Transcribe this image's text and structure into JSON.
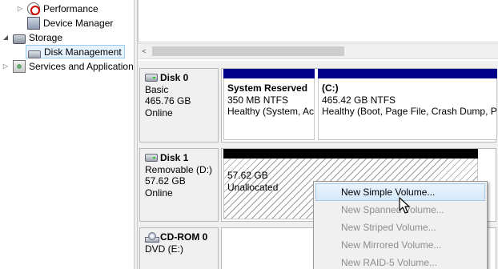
{
  "tree": {
    "items": [
      {
        "label": "Performance",
        "icon": "performance-icon",
        "expander": "▷"
      },
      {
        "label": "Device Manager",
        "icon": "device-manager-icon",
        "expander": ""
      },
      {
        "label": "Storage",
        "icon": "storage-icon",
        "expander": "◢"
      },
      {
        "label": "Disk Management",
        "icon": "disk-management-icon",
        "expander": "",
        "selected": true
      },
      {
        "label": "Services and Applications",
        "icon": "services-icon",
        "expander": "▷"
      }
    ]
  },
  "scroll": {
    "left_arrow": "<"
  },
  "disks": [
    {
      "name": "Disk 0",
      "type": "Basic",
      "size": "465.76 GB",
      "status": "Online",
      "volumes": [
        {
          "name": "System Reserved",
          "size": "350 MB NTFS",
          "status": "Healthy (System, Active, Primary Partition)",
          "bar_color": "#00008b"
        },
        {
          "name": "(C:)",
          "size": "465.42 GB NTFS",
          "status": "Healthy (Boot, Page File, Crash Dump, Primary Partition)",
          "bar_color": "#00008b"
        }
      ]
    },
    {
      "name": "Disk 1",
      "type": "Removable (D:)",
      "size": "57.62 GB",
      "status": "Online",
      "volumes": [
        {
          "name": "",
          "size": "57.62 GB",
          "status": "Unallocated",
          "bar_color": "#000000"
        }
      ]
    },
    {
      "name": "CD-ROM 0",
      "type": "DVD (E:)"
    }
  ],
  "context_menu": {
    "items": [
      {
        "label": "New Simple Volume...",
        "enabled": true,
        "highlighted": true
      },
      {
        "label": "New Spanned Volume...",
        "enabled": false
      },
      {
        "label": "New Striped Volume...",
        "enabled": false
      },
      {
        "label": "New Mirrored Volume...",
        "enabled": false
      },
      {
        "label": "New RAID-5 Volume...",
        "enabled": false
      }
    ]
  },
  "colors": {
    "primary_partition_bar": "#00008b",
    "unallocated_bar": "#000000",
    "menu_highlight": "#d6e8fa"
  }
}
